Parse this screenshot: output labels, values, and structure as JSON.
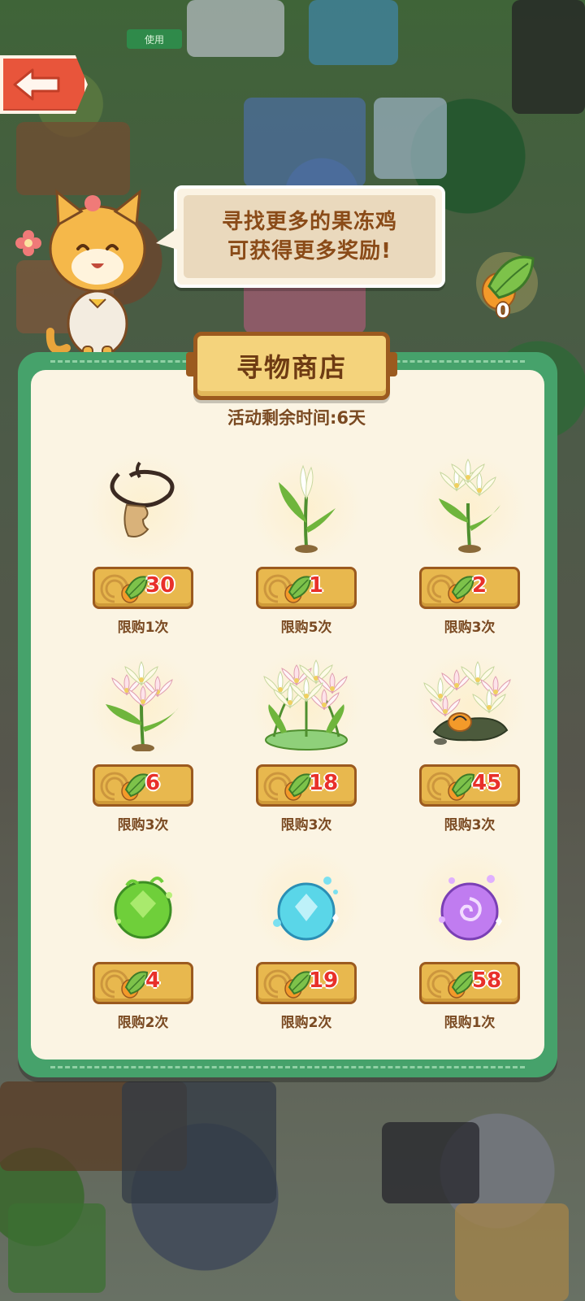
{
  "top": {
    "use_label": "使用"
  },
  "bubble": {
    "line1": "寻找更多的果冻鸡",
    "line2": "可获得更多奖励!"
  },
  "currency": {
    "icon": "leaf-chick-icon",
    "count": "0"
  },
  "shop": {
    "title": "寻物商店",
    "timer": "活动剩余时间:6天",
    "items": [
      {
        "name": "rope-pendant",
        "price": "30",
        "limit": "限购1次"
      },
      {
        "name": "single-lily",
        "price": "1",
        "limit": "限购5次"
      },
      {
        "name": "lily-bunch",
        "price": "2",
        "limit": "限购3次"
      },
      {
        "name": "pink-lily-bunch",
        "price": "6",
        "limit": "限购3次"
      },
      {
        "name": "lily-bush",
        "price": "18",
        "limit": "限购3次"
      },
      {
        "name": "lily-rock-garden",
        "price": "45",
        "limit": "限购3次"
      },
      {
        "name": "green-orb",
        "price": "4",
        "limit": "限购2次"
      },
      {
        "name": "cyan-orb",
        "price": "19",
        "limit": "限购2次"
      },
      {
        "name": "purple-orb",
        "price": "58",
        "limit": "限购1次"
      }
    ]
  },
  "colors": {
    "panel_border": "#46a26b",
    "panel_fill": "#fbf4e3",
    "price_plate": "#e8b84e",
    "price_text": "#e8302a",
    "label_brown": "#7a4a22",
    "back_button": "#e8553b"
  }
}
